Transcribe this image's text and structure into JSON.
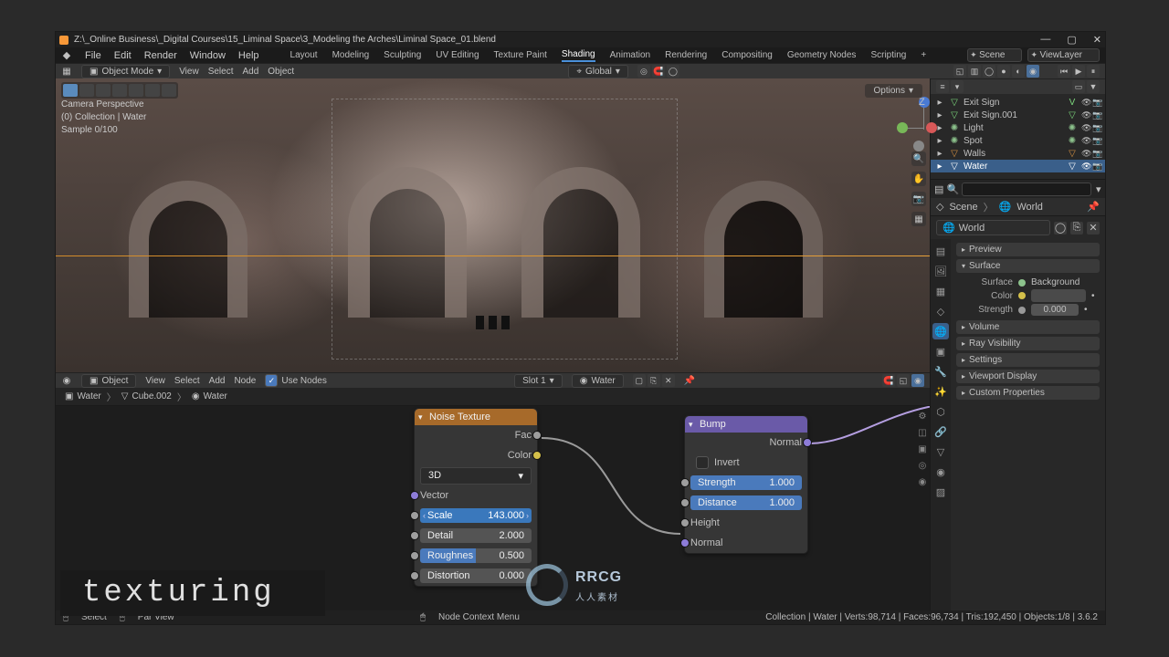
{
  "titlebar": {
    "title": "Z:\\_Online Business\\_Digital Courses\\15_Liminal Space\\3_Modeling the Arches\\Liminal Space_01.blend"
  },
  "menu": {
    "items": [
      "File",
      "Edit",
      "Render",
      "Window",
      "Help"
    ]
  },
  "workspaces": {
    "items": [
      "Layout",
      "Modeling",
      "Sculpting",
      "UV Editing",
      "Texture Paint",
      "Shading",
      "Animation",
      "Rendering",
      "Compositing",
      "Geometry Nodes",
      "Scripting"
    ],
    "active": "Shading"
  },
  "scene_picker": {
    "scene": "Scene",
    "viewlayer": "ViewLayer"
  },
  "headerbar": {
    "mode": "Object Mode",
    "menus": [
      "View",
      "Select",
      "Add",
      "Object"
    ],
    "orientation": "Global"
  },
  "viewport": {
    "options_label": "Options",
    "info": {
      "line1": "Camera Perspective",
      "line2": "(0) Collection | Water",
      "line3": "Sample 0/100"
    }
  },
  "node_header": {
    "mode": "Object",
    "menus": [
      "View",
      "Select",
      "Add",
      "Node"
    ],
    "use_nodes": "Use Nodes",
    "slot": "Slot 1",
    "material": "Water"
  },
  "breadcrumb": {
    "items": [
      "Water",
      "Cube.002",
      "Water"
    ]
  },
  "noise_node": {
    "title": "Noise Texture",
    "out_fac": "Fac",
    "out_color": "Color",
    "dim": "3D",
    "vector_label": "Vector",
    "scale": {
      "label": "Scale",
      "value": "143.000"
    },
    "detail": {
      "label": "Detail",
      "value": "2.000"
    },
    "roughness": {
      "label": "Roughnes",
      "value": "0.500"
    },
    "distortion": {
      "label": "Distortion",
      "value": "0.000"
    }
  },
  "bump_node": {
    "title": "Bump",
    "out_normal": "Normal",
    "invert": "Invert",
    "strength": {
      "label": "Strength",
      "value": "1.000"
    },
    "distance": {
      "label": "Distance",
      "value": "1.000"
    },
    "height": "Height",
    "normal_in": "Normal"
  },
  "outliner": {
    "items": [
      {
        "name": "Exit Sign",
        "icon": "▽",
        "icon_color": "#7cd87c",
        "sub": "V"
      },
      {
        "name": "Exit Sign.001",
        "icon": "▽",
        "icon_color": "#7cd87c",
        "sub": "▽"
      },
      {
        "name": "Light",
        "icon": "✺",
        "icon_color": "#8cc28c",
        "sub": "✺"
      },
      {
        "name": "Spot",
        "icon": "✺",
        "icon_color": "#8cc28c",
        "sub": "✺"
      },
      {
        "name": "Walls",
        "icon": "▽",
        "icon_color": "#d48f42",
        "sub": "▽"
      },
      {
        "name": "Water",
        "icon": "▽",
        "icon_color": "#d48f42",
        "sub": "▽",
        "selected": true
      }
    ]
  },
  "scene_crumb": {
    "scene": "Scene",
    "world": "World"
  },
  "world_pill": "World",
  "panels": {
    "preview": "Preview",
    "surface": "Surface",
    "surface_type": "Background",
    "surface_type_label": "Surface",
    "color_label": "Color",
    "strength_label": "Strength",
    "strength_value": "0.000",
    "volume": "Volume",
    "ray": "Ray Visibility",
    "settings": "Settings",
    "viewport": "Viewport Display",
    "custom": "Custom Properties"
  },
  "status": {
    "left1": "Select",
    "left2": "Par View",
    "mid": "Node Context Menu",
    "right": "Collection | Water | Verts:98,714 | Faces:96,734 | Tris:192,450 | Objects:1/8 | 3.6.2"
  },
  "watermark": {
    "main": "RRCG",
    "sub": "人人素材"
  },
  "banner": {
    "text": "texturing"
  }
}
